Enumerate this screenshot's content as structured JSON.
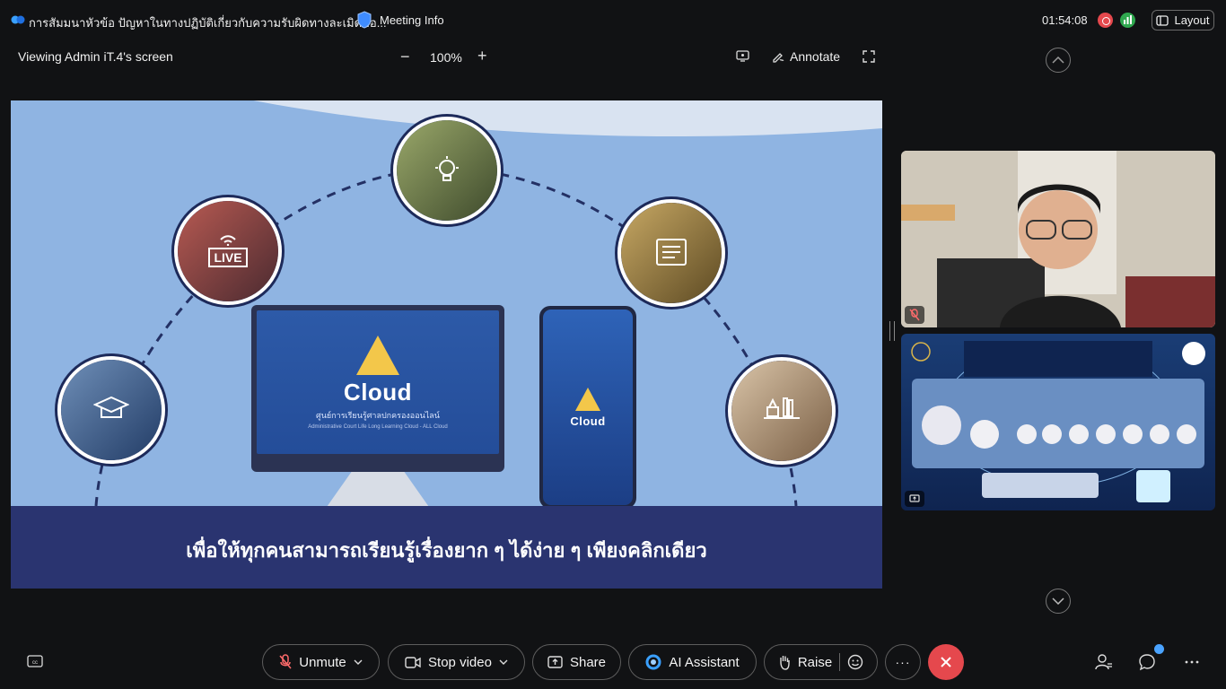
{
  "titlebar": {
    "meeting_title": "การสัมมนาหัวข้อ ปัญหาในทางปฏิบัติเกี่ยวกับความรับผิดทางละเมิดขอ...",
    "meeting_info_label": "Meeting Info",
    "clock": "01:54:08",
    "layout_label": "Layout"
  },
  "share_toolbar": {
    "viewing_label": "Viewing Admin iT.4's screen",
    "zoom_minus": "−",
    "zoom_level": "100%",
    "zoom_plus": "+",
    "annotate_label": "Annotate"
  },
  "slide": {
    "live_label": "LIVE",
    "monitor_word": "Cloud",
    "monitor_subtitle": "ศูนย์การเรียนรู้ศาลปกครองออนไลน์",
    "monitor_subtitle_en": "Administrative Court Life Long Learning Cloud - ALL Cloud",
    "phone_word": "Cloud",
    "caption": "เพื่อให้ทุกคนสามารถเรียนรู้เรื่องยาก ๆ ได้ง่าย ๆ เพียงคลิกเดียว"
  },
  "controls": {
    "unmute_label": "Unmute",
    "stop_video_label": "Stop video",
    "share_label": "Share",
    "ai_assistant_label": "AI Assistant",
    "raise_label": "Raise",
    "more_label": "···"
  },
  "colors": {
    "leave": "#e5484d",
    "slide_bg": "#8fb4e2",
    "slide_footer": "#2a3470",
    "accent": "#4aa3ff"
  },
  "icons": [
    "webex-logo",
    "shield-icon",
    "record-icon",
    "stats-icon",
    "layout-icon",
    "screen-icon",
    "annotate-icon",
    "fullscreen-icon",
    "chevron-up-icon",
    "chevron-down-icon",
    "cc-icon",
    "mic-muted-icon",
    "video-icon",
    "share-icon",
    "ai-icon",
    "hand-icon",
    "emoji-icon",
    "close-icon",
    "participants-icon",
    "chat-icon",
    "more-icon"
  ]
}
